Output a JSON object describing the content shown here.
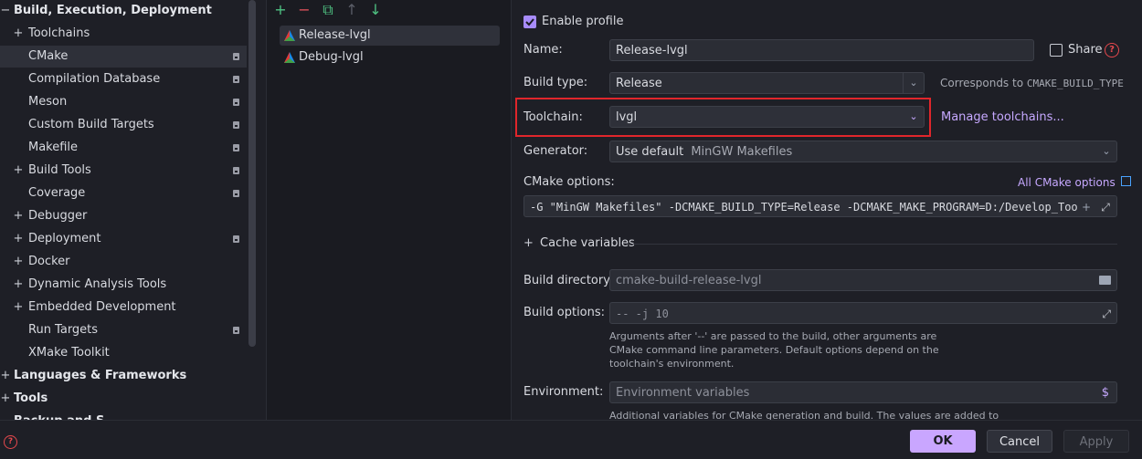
{
  "sidebar": {
    "items": [
      {
        "label": "Build, Execution, Deployment",
        "expander": "−",
        "bold": true,
        "level": 0,
        "badge": false,
        "selected": false
      },
      {
        "label": "Toolchains",
        "expander": "+",
        "bold": false,
        "level": 1,
        "badge": false,
        "selected": false
      },
      {
        "label": "CMake",
        "expander": "",
        "bold": false,
        "level": 1,
        "badge": true,
        "selected": true
      },
      {
        "label": "Compilation Database",
        "expander": "",
        "bold": false,
        "level": 1,
        "badge": true,
        "selected": false
      },
      {
        "label": "Meson",
        "expander": "",
        "bold": false,
        "level": 1,
        "badge": true,
        "selected": false
      },
      {
        "label": "Custom Build Targets",
        "expander": "",
        "bold": false,
        "level": 1,
        "badge": true,
        "selected": false
      },
      {
        "label": "Makefile",
        "expander": "",
        "bold": false,
        "level": 1,
        "badge": true,
        "selected": false
      },
      {
        "label": "Build Tools",
        "expander": "+",
        "bold": false,
        "level": 1,
        "badge": true,
        "selected": false
      },
      {
        "label": "Coverage",
        "expander": "",
        "bold": false,
        "level": 1,
        "badge": true,
        "selected": false
      },
      {
        "label": "Debugger",
        "expander": "+",
        "bold": false,
        "level": 1,
        "badge": false,
        "selected": false
      },
      {
        "label": "Deployment",
        "expander": "+",
        "bold": false,
        "level": 1,
        "badge": true,
        "selected": false
      },
      {
        "label": "Docker",
        "expander": "+",
        "bold": false,
        "level": 1,
        "badge": false,
        "selected": false
      },
      {
        "label": "Dynamic Analysis Tools",
        "expander": "+",
        "bold": false,
        "level": 1,
        "badge": false,
        "selected": false
      },
      {
        "label": "Embedded Development",
        "expander": "+",
        "bold": false,
        "level": 1,
        "badge": false,
        "selected": false
      },
      {
        "label": "Run Targets",
        "expander": "",
        "bold": false,
        "level": 1,
        "badge": true,
        "selected": false
      },
      {
        "label": "XMake Toolkit",
        "expander": "",
        "bold": false,
        "level": 1,
        "badge": false,
        "selected": false
      },
      {
        "label": "Languages & Frameworks",
        "expander": "+",
        "bold": true,
        "level": 0,
        "badge": false,
        "selected": false
      },
      {
        "label": "Tools",
        "expander": "+",
        "bold": true,
        "level": 0,
        "badge": false,
        "selected": false
      },
      {
        "label": "Backup and S...",
        "expander": "",
        "bold": true,
        "level": 0,
        "badge": false,
        "selected": false
      }
    ]
  },
  "profiles": {
    "toolbar": [
      {
        "name": "add-profile-button",
        "glyph": "+",
        "color": "#4fc282"
      },
      {
        "name": "remove-profile-button",
        "glyph": "−",
        "color": "#e0515a"
      },
      {
        "name": "copy-profile-button",
        "glyph": "⧉",
        "color": "#4fc282"
      },
      {
        "name": "move-up-button",
        "glyph": "↑",
        "color": "#5b5e68"
      },
      {
        "name": "move-down-button",
        "glyph": "↓",
        "color": "#4fc282"
      }
    ],
    "items": [
      {
        "label": "Release-lvgl",
        "selected": true
      },
      {
        "label": "Debug-lvgl",
        "selected": false
      }
    ]
  },
  "form": {
    "enable_profile": "Enable profile",
    "name_label": "Name:",
    "name_value": "Release-lvgl",
    "share_label": "Share",
    "build_type_label": "Build type:",
    "build_type_value": "Release",
    "build_type_hint_prefix": "Corresponds to",
    "build_type_hint_code": "CMAKE_BUILD_TYPE",
    "toolchain_label": "Toolchain:",
    "toolchain_value": "lvgl",
    "manage_toolchains": "Manage toolchains...",
    "generator_label": "Generator:",
    "generator_value": "Use default",
    "generator_default": "MinGW Makefiles",
    "cmake_options_label": "CMake options:",
    "all_cmake_options": "All CMake options",
    "cmake_options_value": "-G \"MinGW Makefiles\" -DCMAKE_BUILD_TYPE=Release -DCMAKE_MAKE_PROGRAM=D:/Develop_Tool/",
    "cache_variables": "Cache variables",
    "build_directory_label": "Build directory:",
    "build_directory_value": "cmake-build-release-lvgl",
    "build_options_label": "Build options:",
    "build_options_value": "-- -j 10",
    "build_options_help": "Arguments after '--' are passed to the build, other arguments are CMake command line parameters. Default options depend on the toolchain's environment.",
    "environment_label": "Environment:",
    "environment_placeholder": "Environment variables",
    "environment_help": "Additional variables for CMake generation and build. The values are added to"
  },
  "buttons": {
    "ok": "OK",
    "cancel": "Cancel",
    "apply": "Apply"
  },
  "colors": {
    "accent": "#c9a6ff",
    "highlight_box": "#e0262b",
    "checkbox": "#a78bfa"
  }
}
